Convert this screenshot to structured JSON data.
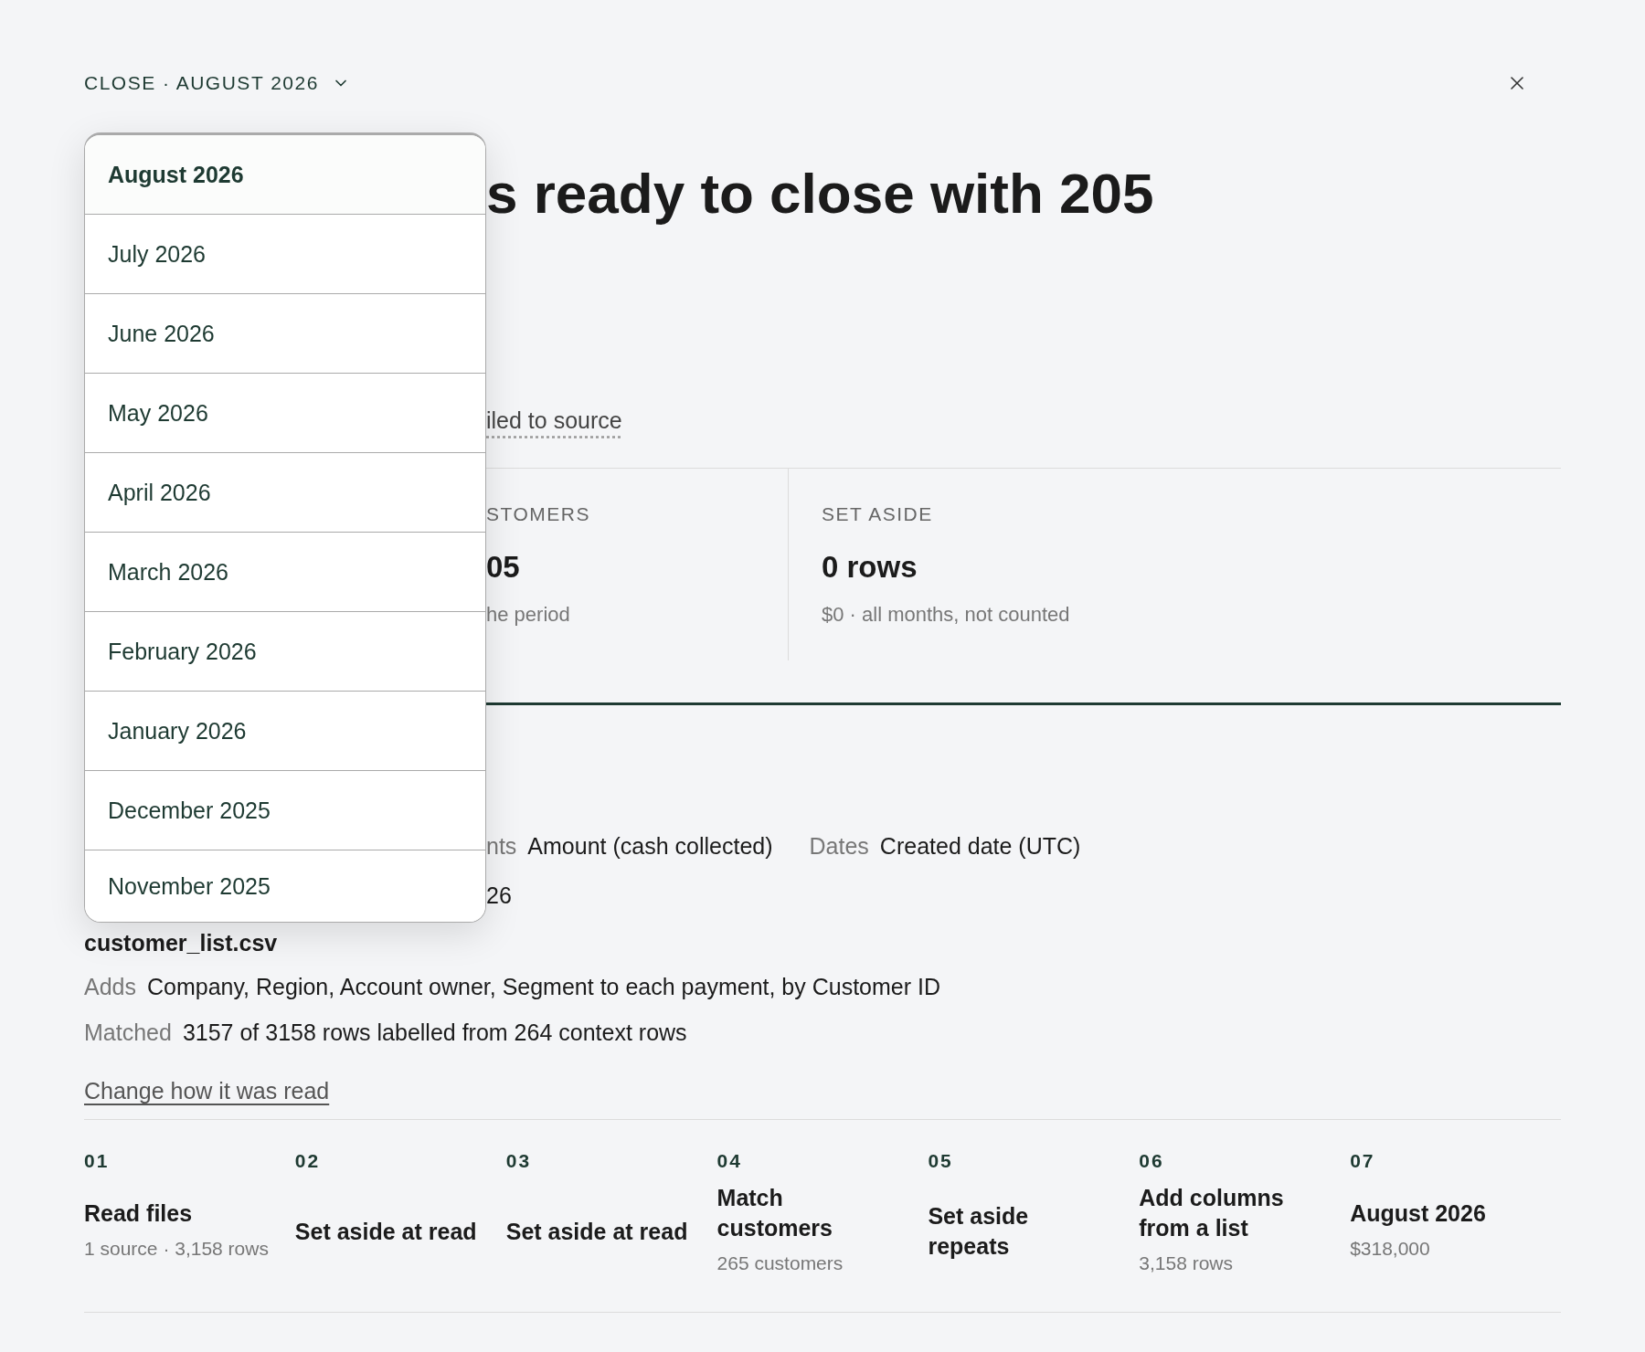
{
  "header": {
    "title": "CLOSE · AUGUST 2026",
    "expanded": true
  },
  "headline": "s ready to close with 205",
  "source_link": "iled to source",
  "stats": [
    {
      "label": "STOMERS",
      "value": "05",
      "note": "he period"
    },
    {
      "label": "SET ASIDE",
      "value": "0 rows",
      "note": "$0 · all months, not counted"
    }
  ],
  "details": {
    "fields": [
      {
        "label": "nts",
        "value": "Amount (cash collected)"
      },
      {
        "label": "Dates",
        "value": "Created date (UTC)"
      }
    ],
    "fragment": "26"
  },
  "file": {
    "name": "customer_list.csv",
    "rows": [
      {
        "label": "Adds",
        "value": "Company, Region, Account owner, Segment to each payment, by Customer ID"
      },
      {
        "label": "Matched",
        "value": "3157 of 3158 rows labelled from 264 context rows"
      }
    ]
  },
  "change_link": "Change how it was read",
  "steps": [
    {
      "number": "01",
      "title": "Read files",
      "note": "1 source · 3,158 rows"
    },
    {
      "number": "02",
      "title": "Set aside at read"
    },
    {
      "number": "03",
      "title": "Set aside at read"
    },
    {
      "number": "04",
      "title": "Match customers",
      "note": "265 customers"
    },
    {
      "number": "05",
      "title": "Set aside repeats"
    },
    {
      "number": "06",
      "title": "Add columns from a list",
      "note": "3,158 rows"
    },
    {
      "number": "07",
      "title": "August 2026",
      "note": "$318,000"
    }
  ],
  "month_menu": [
    {
      "label": "August 2026",
      "selected": true
    },
    {
      "label": "July 2026",
      "selected": false
    },
    {
      "label": "June 2026",
      "selected": false
    },
    {
      "label": "May 2026",
      "selected": false
    },
    {
      "label": "April 2026",
      "selected": false
    },
    {
      "label": "March 2026",
      "selected": false
    },
    {
      "label": "February 2026",
      "selected": false
    },
    {
      "label": "January 2026",
      "selected": false
    },
    {
      "label": "December 2025",
      "selected": false
    },
    {
      "label": "November 2025",
      "selected": false
    }
  ]
}
